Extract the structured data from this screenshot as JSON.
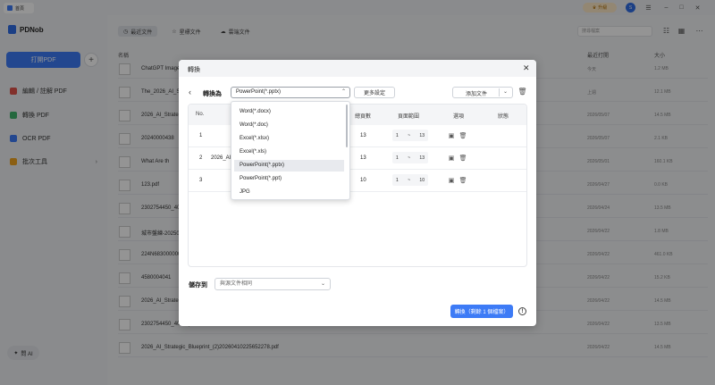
{
  "titlebar": {
    "home_tab": "首頁",
    "upgrade": "升級",
    "avatar": "S"
  },
  "sidebar": {
    "app_name": "PDNob",
    "open_pdf": "打開PDF",
    "plus": "+",
    "items": [
      {
        "label": "編輯 / 註解 PDF",
        "color": "#e0534a"
      },
      {
        "label": "轉換 PDF",
        "color": "#3fb36b"
      },
      {
        "label": "OCR PDF",
        "color": "#3d7bf6"
      },
      {
        "label": "批次工具",
        "color": "#f0a422"
      }
    ],
    "ai": "問 AI"
  },
  "main": {
    "tabs": [
      {
        "label": "最近文件",
        "icon": "clock-icon"
      },
      {
        "label": "星標文件",
        "icon": "star-icon"
      },
      {
        "label": "雲端文件",
        "icon": "cloud-icon"
      }
    ],
    "search_placeholder": "搜尋檔案",
    "headers": {
      "name": "名稱",
      "date": "最近打開",
      "size": "大小"
    },
    "files": [
      {
        "name": "ChatGPT Image",
        "date": "今天",
        "size": "1.2 MB"
      },
      {
        "name": "The_2026_AI_S",
        "date": "上週",
        "size": "12.1 MB"
      },
      {
        "name": "2026_AI_Strate",
        "date": "2026/05/07",
        "size": "14.5 MB"
      },
      {
        "name": "20240000438",
        "date": "2026/05/07",
        "size": "2.1 KB"
      },
      {
        "name": "What Are th",
        "date": "2026/05/01",
        "size": "160.1 KB"
      },
      {
        "name": "123.pdf",
        "date": "2026/04/27",
        "size": "0.0 KB"
      },
      {
        "name": "2302754450_40",
        "date": "2026/04/24",
        "size": "13.5 MB"
      },
      {
        "name": "城市盤練-20250",
        "date": "2026/04/22",
        "size": "1.8 MB"
      },
      {
        "name": "224N683000000",
        "date": "2026/04/22",
        "size": "461.0 KB"
      },
      {
        "name": "4580004041",
        "date": "2026/04/22",
        "size": "15.2 KB"
      },
      {
        "name": "2026_AI_Strate",
        "date": "2026/04/22",
        "size": "14.5 MB"
      },
      {
        "name": "2302754450_40GP.pdf",
        "date": "2026/04/22",
        "size": "13.5 MB"
      },
      {
        "name": "2026_AI_Strategic_Blueprint_(2)20260410225652278.pdf",
        "date": "2026/04/22",
        "size": "14.5 MB"
      }
    ]
  },
  "dialog": {
    "title": "轉換",
    "convert_to_label": "轉換為",
    "selected_format": "PowerPoint(*.pptx)",
    "more_settings": "更多設定",
    "add_file": "添加文件",
    "columns": {
      "no": "No.",
      "pages": "總頁數",
      "range": "頁面範圍",
      "options": "選項",
      "status": "狀態"
    },
    "rows": [
      {
        "no": "1",
        "name": "",
        "pages": "13",
        "from": "1",
        "to": "13"
      },
      {
        "no": "2",
        "name": "2026_AI_S",
        "pages": "13",
        "from": "1",
        "to": "13"
      },
      {
        "no": "3",
        "name": "",
        "pages": "10",
        "from": "1",
        "to": "10"
      }
    ],
    "range_sep": "~",
    "formats": [
      "Word(*.docx)",
      "Word(*.doc)",
      "Excel(*.xlsx)",
      "Excel(*.xls)",
      "PowerPoint(*.pptx)",
      "PowerPoint(*.ppt)",
      "JPG"
    ],
    "save_to_label": "儲存到",
    "save_to_value": "與源文件相同",
    "convert_button": "轉換（剩餘 1 個檔案）",
    "accent": "#3d7bf6"
  }
}
